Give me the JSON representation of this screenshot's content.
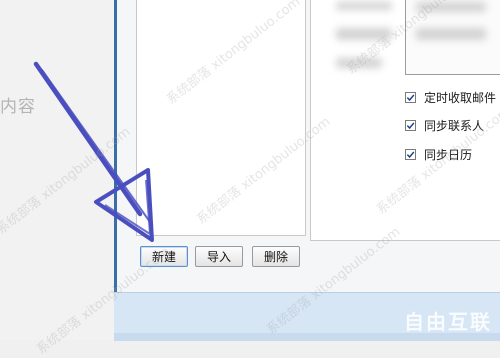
{
  "background": {
    "content_label": "内容"
  },
  "settings": {
    "options": [
      {
        "label": "定时收取邮件",
        "checked": true
      },
      {
        "label": "同步联系人",
        "checked": true
      },
      {
        "label": "同步日历",
        "checked": true
      }
    ]
  },
  "buttons": {
    "new_label": "新建",
    "import_label": "导入",
    "delete_label": "删除"
  },
  "watermark": {
    "text": "系统部落 xitongbuluo.com",
    "logo": "自由互联"
  },
  "colors": {
    "dialog_border": "#3a6ea8",
    "arrow": "#4a4fc0",
    "footer": "#d6e6f5"
  },
  "icons": {
    "checkbox": "check-icon",
    "annotation": "arrow-icon"
  }
}
